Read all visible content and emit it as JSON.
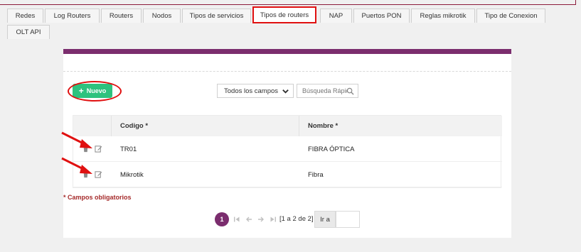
{
  "tabs": [
    {
      "label": "Redes"
    },
    {
      "label": "Log Routers"
    },
    {
      "label": "Routers"
    },
    {
      "label": "Nodos"
    },
    {
      "label": "Tipos de servicios"
    },
    {
      "label": "Tipos de routers"
    },
    {
      "label": "NAP"
    },
    {
      "label": "Puertos PON"
    },
    {
      "label": "Reglas mikrotik"
    },
    {
      "label": "Tipo de Conexion"
    },
    {
      "label": "OLT API"
    }
  ],
  "active_tab": "Tipos de routers",
  "toolbar": {
    "new_label": "Nuevo",
    "field_select": "Todos los campos",
    "search_placeholder": "Búsqueda Rápida"
  },
  "table": {
    "columns": [
      "Codigo *",
      "Nombre *"
    ],
    "rows": [
      {
        "codigo": "TR01",
        "nombre": "FIBRA ÓPTICA"
      },
      {
        "codigo": "Mikrotik",
        "nombre": "Fibra"
      }
    ]
  },
  "required_note": "* Campos obligatorios",
  "pagination": {
    "current_page": "1",
    "range_text": "[1 a 2 de 2]",
    "goto_label": "Ir a"
  },
  "colors": {
    "accent": "#7b2d6e",
    "new_button": "#2ec27e",
    "highlight": "#e01010",
    "required_text": "#a52a2a"
  },
  "icons": {
    "delete": "trash-icon",
    "edit": "edit-icon",
    "select": "chevron-down-icon",
    "search": "search-icon",
    "first": "first-page-icon",
    "prev": "prev-page-icon",
    "next": "next-page-icon",
    "last": "last-page-icon"
  }
}
